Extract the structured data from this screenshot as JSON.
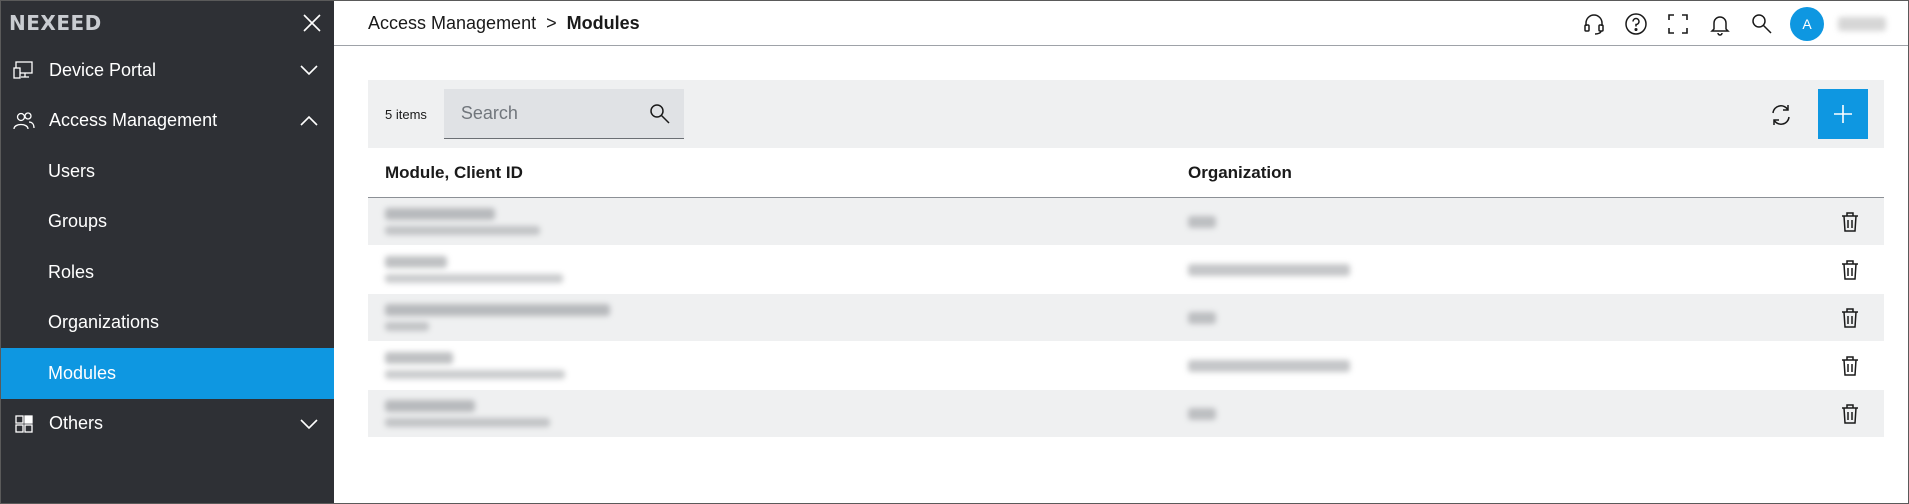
{
  "brand": "NEXEED",
  "sidebar": {
    "device_portal": "Device Portal",
    "access_management": "Access Management",
    "sub_items": [
      "Users",
      "Groups",
      "Roles",
      "Organizations",
      "Modules"
    ],
    "active_sub_item": "Modules",
    "others": "Others"
  },
  "breadcrumb": {
    "parent": "Access Management",
    "separator": ">",
    "current": "Modules"
  },
  "header_icons": [
    "headset-icon",
    "help-icon",
    "fullscreen-icon",
    "bell-icon",
    "search-icon"
  ],
  "avatar_initial": "A",
  "toolbar": {
    "count": "5 items",
    "search_placeholder": "Search"
  },
  "table": {
    "col_module": "Module, Client ID",
    "col_org": "Organization",
    "row_count": 5
  },
  "colors": {
    "sidebar_bg": "#2e3035",
    "accent": "#0e97e1",
    "toolbar_bg": "#eff0f1"
  }
}
